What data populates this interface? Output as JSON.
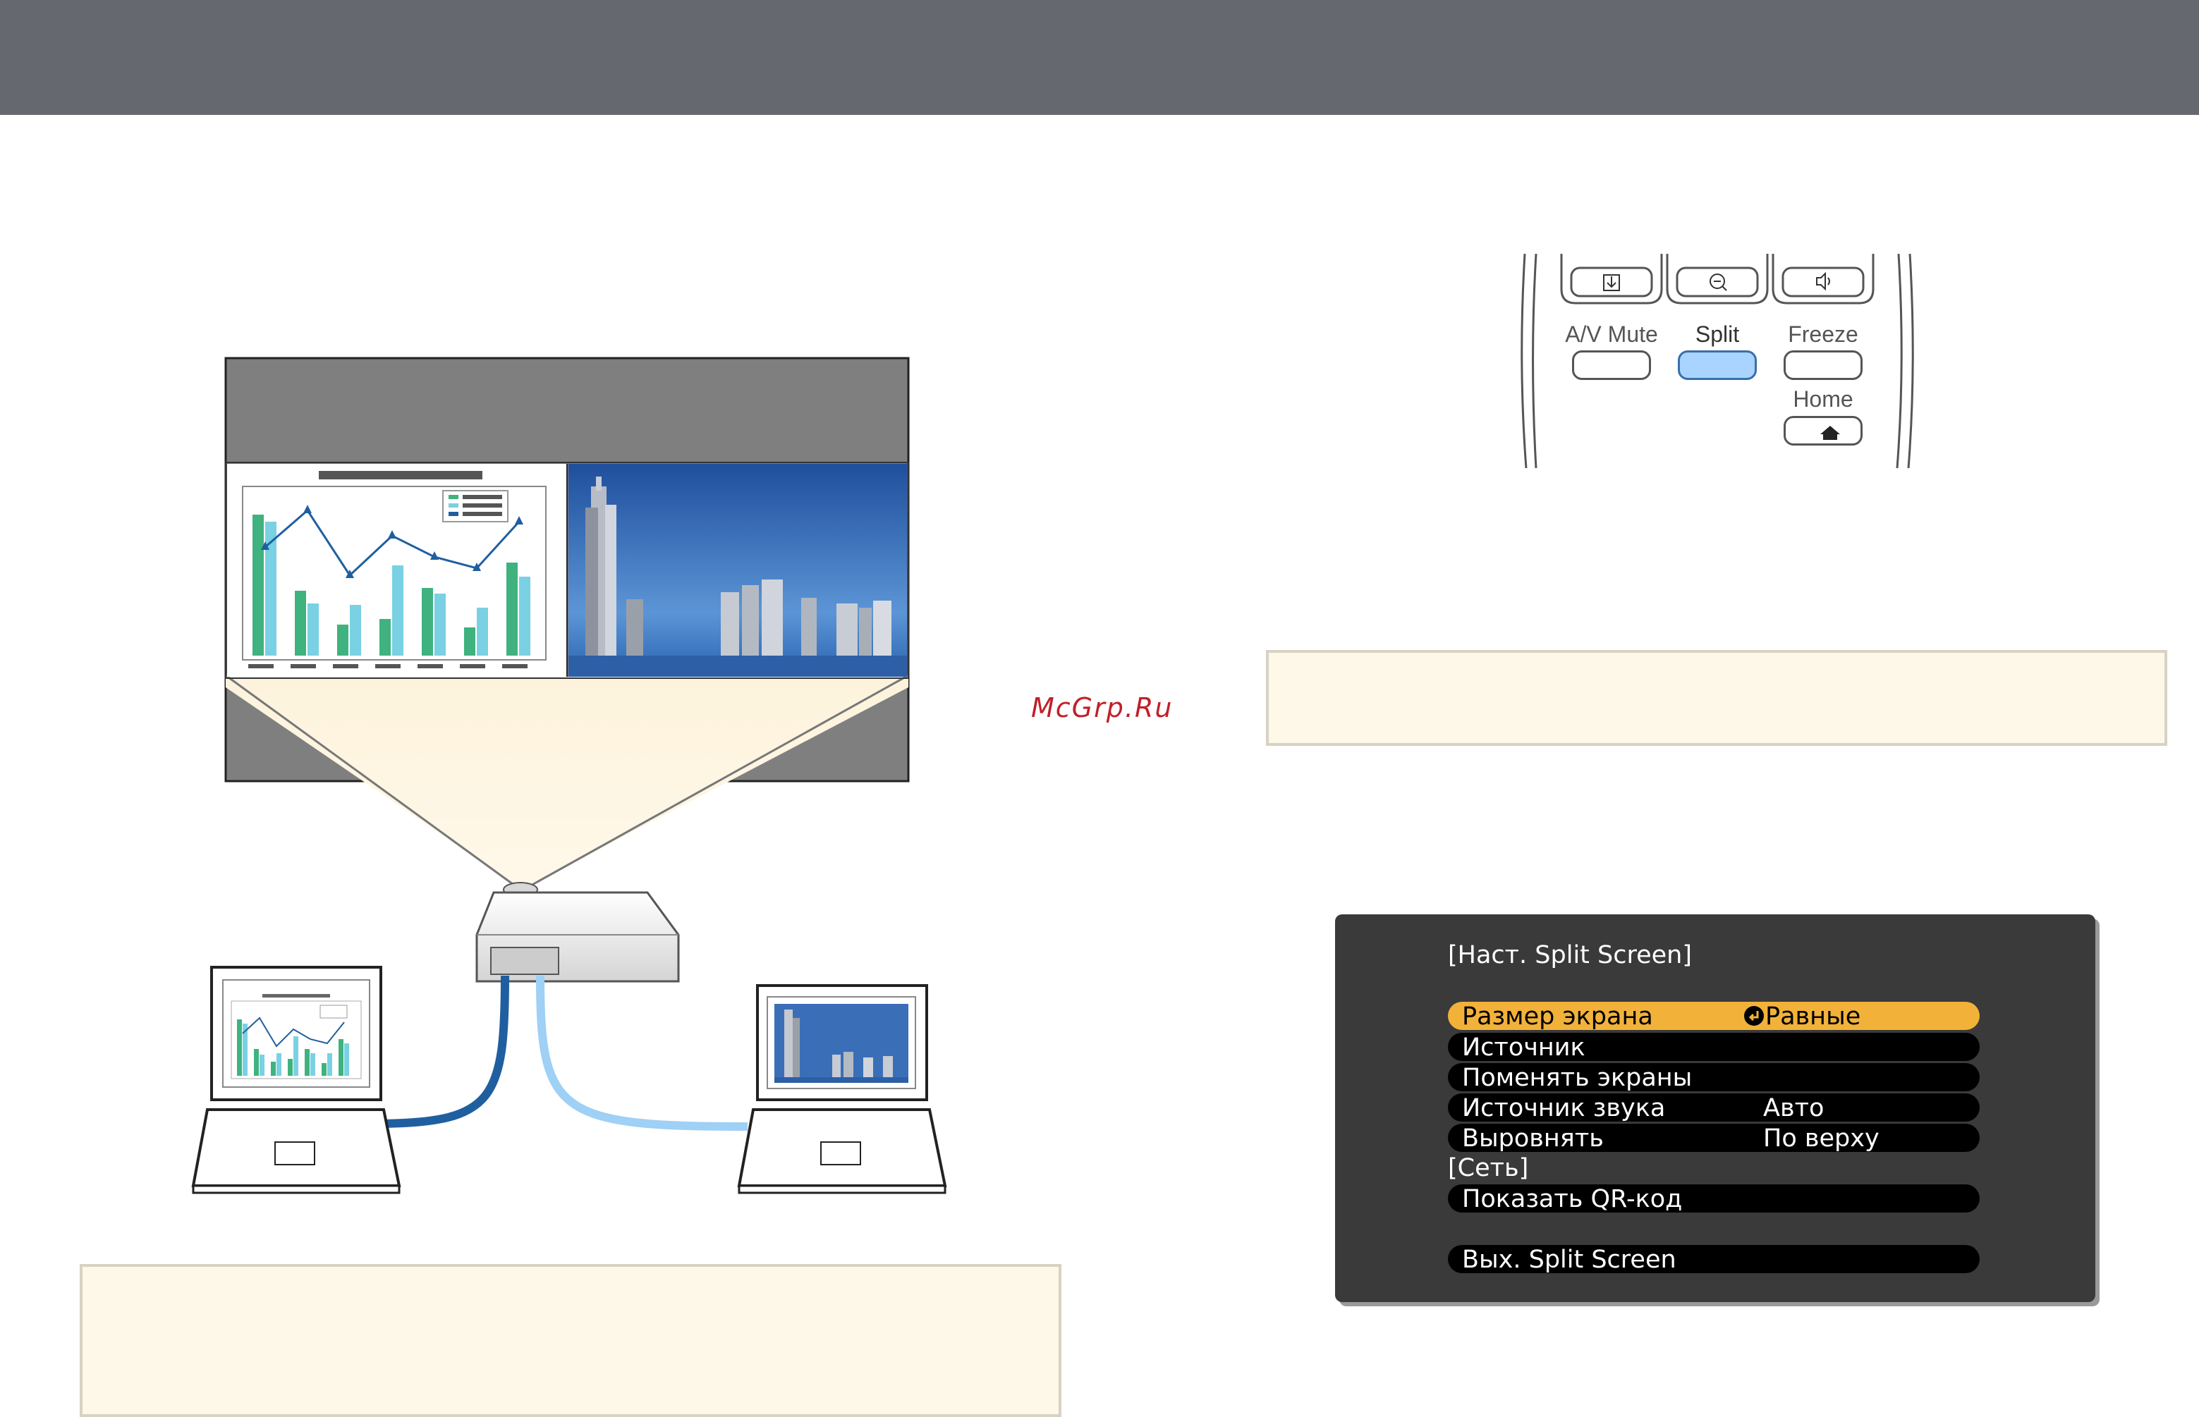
{
  "watermark": "McGrp.Ru",
  "remote": {
    "buttons": [
      {
        "label": "A/V Mute"
      },
      {
        "label": "Split"
      },
      {
        "label": "Freeze"
      },
      {
        "label": "Home"
      }
    ]
  },
  "osd": {
    "title": "[Наст. Split Screen]",
    "items": [
      {
        "label": "Размер экрана",
        "value": "Равные",
        "selected": true
      },
      {
        "label": "Источник",
        "value": ""
      },
      {
        "label": "Поменять экраны",
        "value": ""
      },
      {
        "label": "Источник звука",
        "value": "Авто"
      },
      {
        "label": "Выровнять",
        "value": "По верху"
      }
    ],
    "section": "[Сеть]",
    "qr_item": "Показать QR-код",
    "exit_item": "Вых. Split Screen"
  },
  "colors": {
    "header_bar": "#666870",
    "note_background": "#fdf8e8",
    "osd_highlight": "#f2b23a",
    "split_button": "#a8d4ff",
    "cable_dark": "#1f5fa0",
    "cable_light": "#9fd0f5"
  }
}
